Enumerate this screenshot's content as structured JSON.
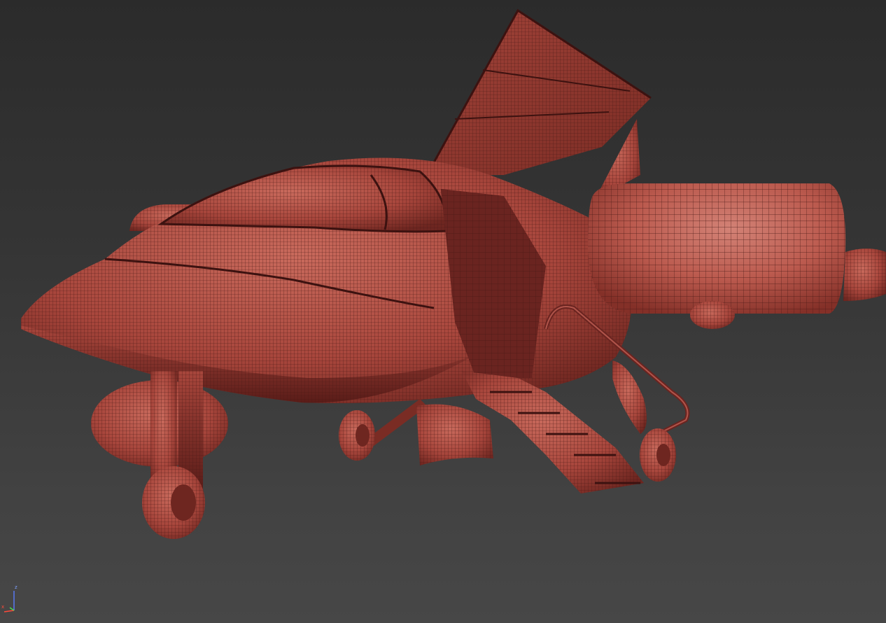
{
  "viewport": {
    "mode": "wireframe-shaded",
    "background_top": "#2b2b2b",
    "background_bottom": "#474747",
    "mesh_color": "#c8584c",
    "wire_color": "#4a1a16"
  },
  "model": {
    "subject": "vtol-aircraft-mesh",
    "parts": [
      "fuselage",
      "canopy",
      "open-door",
      "vertical-fin",
      "ducted-fan-right",
      "ducted-fan-left",
      "nose-landing-gear",
      "main-landing-gear-left",
      "main-landing-gear-right",
      "boarding-stairs",
      "stair-handrail"
    ]
  },
  "axis_gizmo": {
    "z_label": "z",
    "x_label": "x",
    "z_color": "#5a7dff",
    "x_color": "#ff4a3a",
    "y_color": "#4adf4a"
  }
}
